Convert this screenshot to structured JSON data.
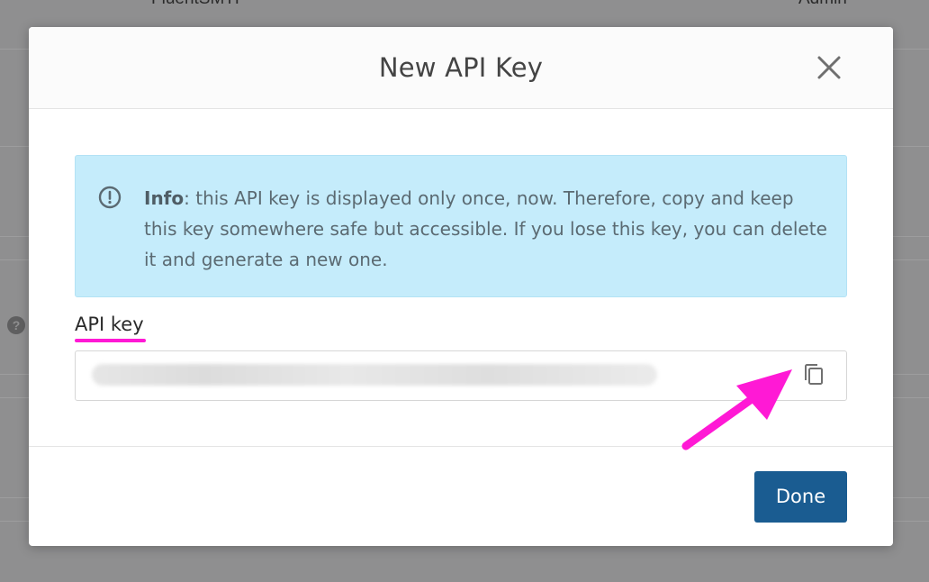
{
  "background": {
    "left_text": "FluentSMTP",
    "right_text": "Admin",
    "help_icon": "question-circle-icon"
  },
  "modal": {
    "title": "New API Key",
    "close_icon": "close-icon",
    "info": {
      "icon": "exclamation-circle-icon",
      "label": "Info",
      "message": ": this API key is displayed only once, now. Therefore, copy and keep this key somewhere safe but accessible. If you lose this key, you can delete it and generate a new one."
    },
    "api_key_label": "API key",
    "api_key_value": "",
    "copy_icon": "copy-icon",
    "done_label": "Done"
  },
  "annotation": {
    "arrow_color": "#ff19d5",
    "underline_color": "#ff19d5"
  },
  "colors": {
    "info_bg": "#c5ecfb",
    "primary_button": "#1a5c91",
    "overlay": "#8f8f90"
  }
}
